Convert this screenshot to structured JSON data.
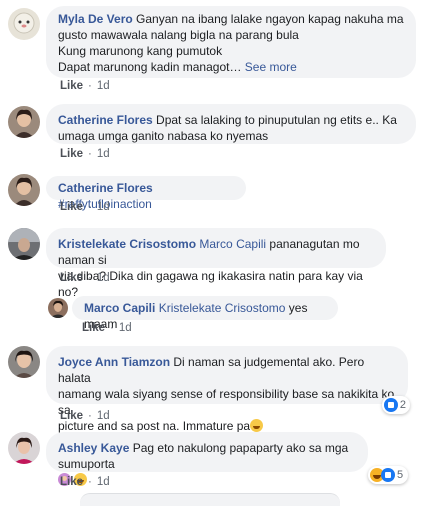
{
  "comments": [
    {
      "name": "Myla De Vero",
      "lines": [
        "Ganyan na ibang lalake ngayon kapag nakuha ma",
        "gusto mawawala nalang bigla na parang bula",
        "Kung marunong kang pumutok",
        "Dapat marunong kadin managot…"
      ],
      "see_more": "See more",
      "like": "Like",
      "time": "1d"
    },
    {
      "name": "Catherine Flores",
      "lines": [
        "Dpat sa lalaking to pinuputulan ng etits e.. Ka",
        "umaga umga ganito nabasa ko nyemas"
      ],
      "like": "Like",
      "time": "1d"
    },
    {
      "name": "Catherine Flores",
      "text": "#raffytufloinaction",
      "like": "Like",
      "time": "1d"
    },
    {
      "name": "Kristelekate Crisostomo",
      "mention": "Marco Capili",
      "text_first": "pananagutan mo naman si",
      "line2": "via diba? Dika din gagawa ng ikakasira natin para kay via no?",
      "like": "Like",
      "time": "1d"
    },
    {
      "name": "Marco Capili",
      "mention": "Kristelekate Crisostomo",
      "text": "yes maam",
      "like": "Like",
      "time": "1d"
    },
    {
      "name": "Joyce Ann Tiamzon",
      "lines": [
        "Di naman sa judgemental ako. Pero halata",
        "namang wala siyang sense of responsibility base sa nakikita ko sa",
        "picture and sa post na. Immature pa"
      ],
      "like": "Like",
      "time": "1d",
      "reaction_count": "2",
      "emoji": "grinning-emoji"
    },
    {
      "name": "Ashley Kaye",
      "text": "Pag eto nakulong papaparty ako sa mga sumuporta",
      "like": "Like",
      "time": "1d",
      "reaction_count": "5",
      "emojis": [
        "woman-emoji",
        "laughing-emoji"
      ]
    }
  ],
  "separator": "·",
  "colors": {
    "name": "#385898",
    "bubble": "#f2f3f5",
    "meta": "#606770",
    "like_reaction": "#1877f2",
    "haha_reaction": "#f7b125"
  }
}
